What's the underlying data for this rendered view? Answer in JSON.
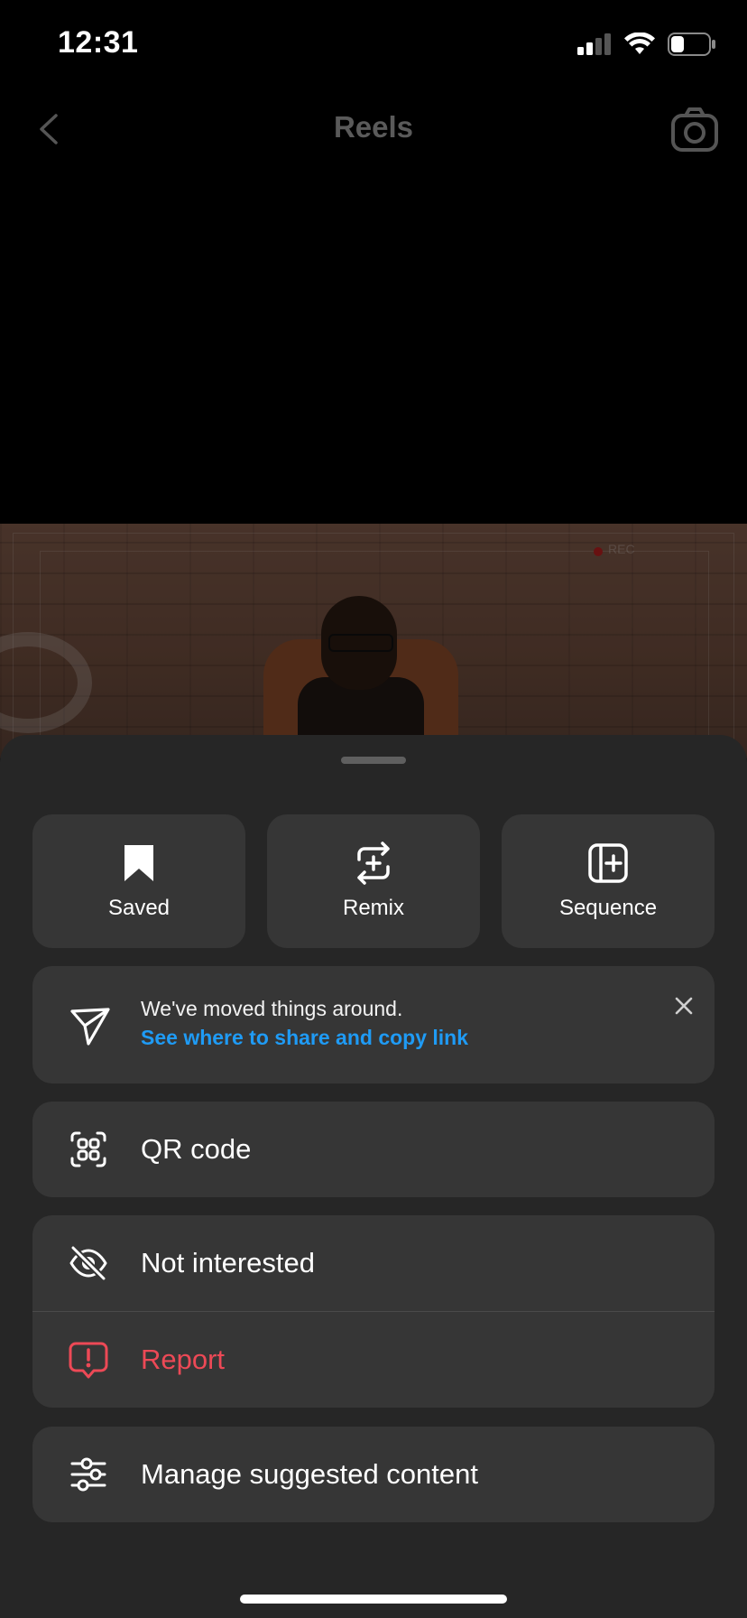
{
  "status_bar": {
    "time": "12:31",
    "icons": [
      "signal-icon",
      "wifi-icon",
      "battery-icon"
    ]
  },
  "nav": {
    "title": "Reels",
    "back_icon": "chevron-left-icon",
    "camera_icon": "camera-icon"
  },
  "video": {
    "rec_label": "REC"
  },
  "sheet": {
    "tiles": [
      {
        "label": "Saved",
        "icon": "bookmark-icon"
      },
      {
        "label": "Remix",
        "icon": "remix-icon"
      },
      {
        "label": "Sequence",
        "icon": "sequence-icon"
      }
    ],
    "notice": {
      "text": "We've moved things around.",
      "link": "See where to share and copy link",
      "icon": "paper-plane-icon",
      "close_icon": "close-icon"
    },
    "qr": {
      "label": "QR code",
      "icon": "qr-code-icon"
    },
    "not_interested": {
      "label": "Not interested",
      "icon": "eye-off-icon"
    },
    "report": {
      "label": "Report",
      "icon": "report-icon"
    },
    "manage": {
      "label": "Manage suggested content",
      "icon": "sliders-icon"
    }
  },
  "colors": {
    "sheet_bg": "#262626",
    "card_bg": "#363636",
    "link": "#1f9bf5",
    "danger": "#ed4956"
  }
}
